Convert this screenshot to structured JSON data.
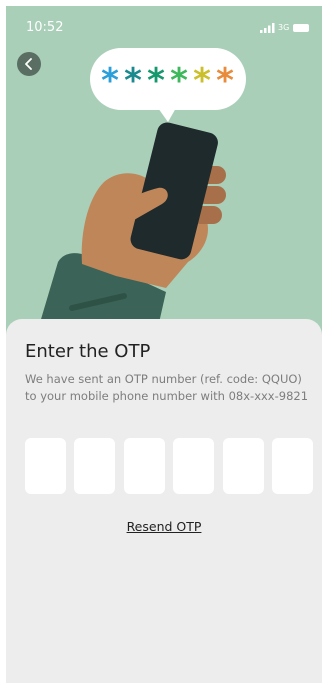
{
  "status_bar": {
    "time": "10:52",
    "network": "3G"
  },
  "icons": {
    "back": "chevron-left-icon",
    "signal": "signal-bars-icon",
    "battery": "battery-icon"
  },
  "illustration": {
    "masked_code": "******",
    "asterisk_colors": [
      "#2b9fd9",
      "#1b8a8f",
      "#16986f",
      "#3db85c",
      "#cbbf2b",
      "#e88b3a"
    ]
  },
  "otp": {
    "title": "Enter the OTP",
    "description": "We have sent an OTP number (ref. code: QQUO) to your mobile phone number with 08x-xxx-9821",
    "digits": [
      "",
      "",
      "",
      "",
      "",
      ""
    ],
    "resend_label": "Resend OTP"
  },
  "colors": {
    "hero_background": "#a9cfb8",
    "sheet_background": "#ededed",
    "sleeve": "#3b6357",
    "skin": "#bf8659",
    "phone_body": "#1e2a2b"
  }
}
